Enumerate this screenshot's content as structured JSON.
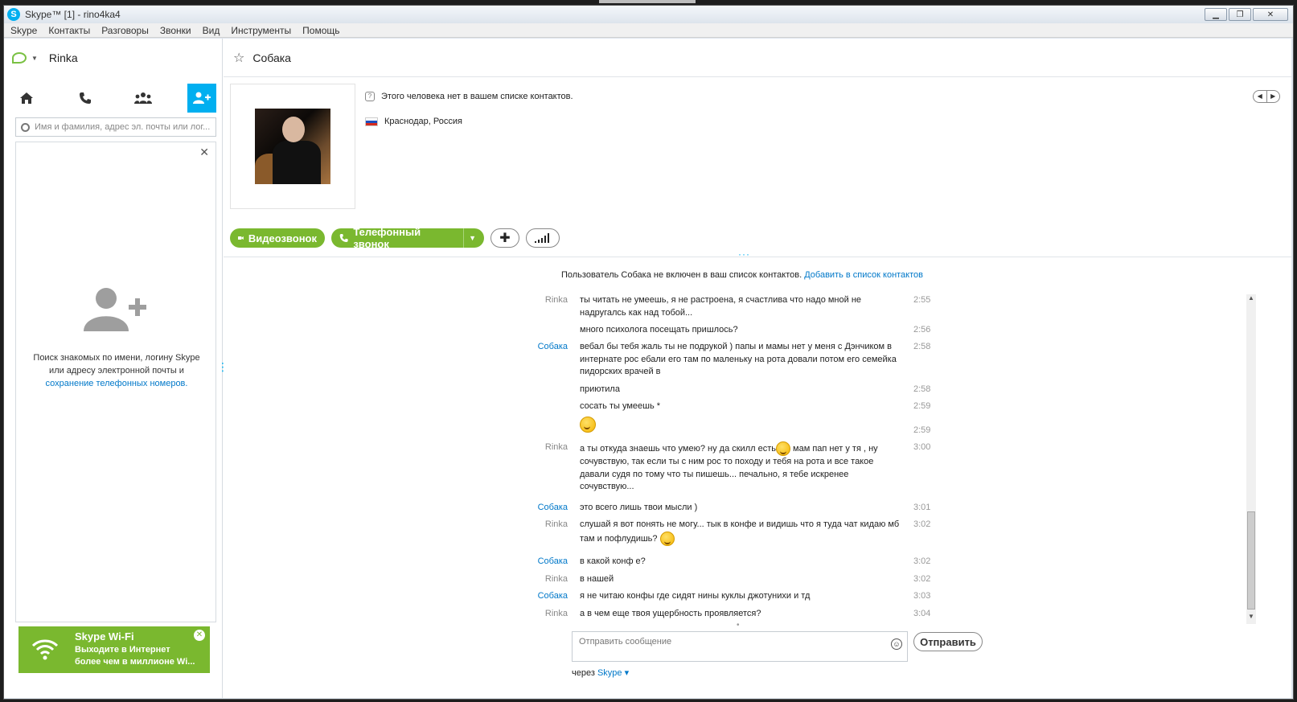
{
  "window": {
    "title": "Skype™ [1] - rino4ka4"
  },
  "menu": [
    "Skype",
    "Контакты",
    "Разговоры",
    "Звонки",
    "Вид",
    "Инструменты",
    "Помощь"
  ],
  "user": {
    "name": "Rinka"
  },
  "search": {
    "placeholder": "Имя и фамилия, адрес эл. почты или лог..."
  },
  "empty_state": {
    "text": "Поиск знакомых по имени, логину Skype или адресу электронной почты и ",
    "link": "сохранение телефонных номеров."
  },
  "wifi": {
    "title": "Skype Wi-Fi",
    "line1": "Выходите в Интернет",
    "line2": "более чем в миллионе Wi..."
  },
  "contact": {
    "name": "Собака",
    "not_in_list": "Этого человека нет в вашем списке контактов.",
    "location": "Краснодар, Россия"
  },
  "actions": {
    "video": "Видеозвонок",
    "phone": "Телефонный звонок"
  },
  "notice": {
    "text": "Пользователь Собака не включен в ваш список контактов. ",
    "link": "Добавить в список контактов"
  },
  "messages": [
    {
      "sender": "Rinka",
      "who": "me",
      "text": "ты читать не умеешь, я не растроена, я счастлива что надо мной не надругалсь как над тобой...",
      "time": "2:55"
    },
    {
      "sender": "",
      "who": "me",
      "text": "много психолога посещать пришлось?",
      "time": "2:56"
    },
    {
      "sender": "Собака",
      "who": "them",
      "text": "вебал бы тебя жаль ты не подрукой ) папы и мамы нет у меня с Дэнчиком в интернате рос ебали его там по маленьку на рота довали потом его семейка пидорских врачей в",
      "time": "2:58"
    },
    {
      "sender": "",
      "who": "them",
      "text": "приютила",
      "time": "2:58"
    },
    {
      "sender": "",
      "who": "them",
      "text": "сосать ты умеешь *",
      "time": "2:59"
    },
    {
      "sender": "",
      "who": "them",
      "text": "",
      "time": "2:59"
    },
    {
      "sender": "Rinka",
      "who": "me",
      "text": "а ты откуда знаешь что умею? ну да скилл есть",
      "text2": "мам пап нет у тя , ну сочувствую, так если ты с ним рос то походу и тебя на рота и все такое давали судя по тому что ты пишешь... печально, я тебе искренее сочувствую...",
      "time": "3:00"
    },
    {
      "sender": "Собака",
      "who": "them",
      "text": "это всего лишь твои мысли )",
      "time": "3:01"
    },
    {
      "sender": "Rinka",
      "who": "me",
      "text": "слушай я вот понять не могу... тык в конфе и видишь что я туда чат кидаю мб там и пофлудишь?",
      "time": "3:02"
    },
    {
      "sender": "Собака",
      "who": "them",
      "text": "в какой конф е?",
      "time": "3:02"
    },
    {
      "sender": "Rinka",
      "who": "me",
      "text": "в нашей",
      "time": "3:02"
    },
    {
      "sender": "Собака",
      "who": "them",
      "text": "я не читаю конфы где сидят нины куклы джотунихи и тд",
      "time": "3:03"
    },
    {
      "sender": "Rinka",
      "who": "me",
      "text": "а в чем еще твоя ущербность проявляется?",
      "time": "3:04"
    }
  ],
  "compose": {
    "placeholder": "Отправить сообщение",
    "send": "Отправить",
    "via": "через ",
    "via_link": "Skype"
  },
  "colors": {
    "accent": "#00aff0",
    "green": "#7ab82f",
    "link": "#0078c9"
  }
}
